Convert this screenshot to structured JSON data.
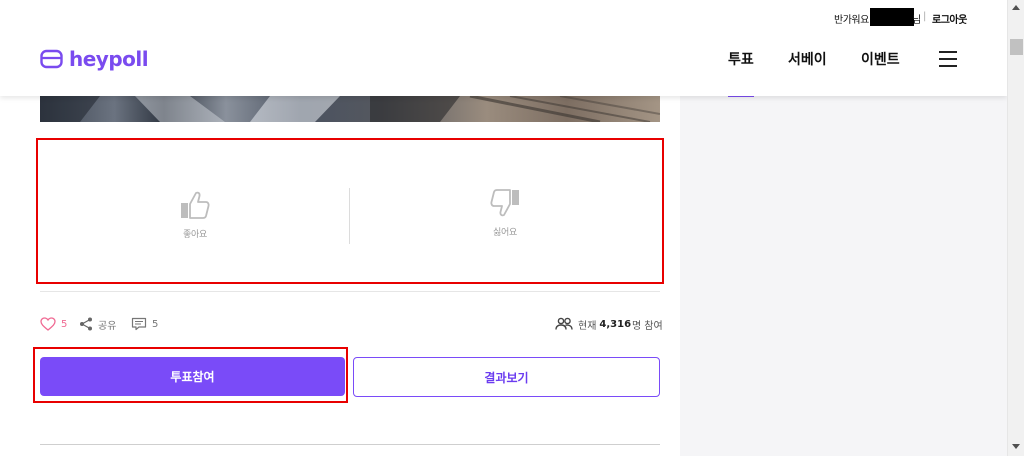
{
  "header": {
    "greeting": "반가워요",
    "greeting_suffix": "님",
    "separator": "|",
    "logout_label": "로그아웃",
    "logo_text": "heypoll",
    "nav": [
      {
        "label": "투표"
      },
      {
        "label": "서베이"
      },
      {
        "label": "이벤트"
      }
    ],
    "menu_icon": "hamburger-icon"
  },
  "vote_panel": {
    "like_label": "좋아요",
    "dislike_label": "싫어요",
    "like_icon": "thumbs-up-icon",
    "dislike_icon": "thumbs-down-icon"
  },
  "stats": {
    "likes": "5",
    "share_label": "공유",
    "comments": "5",
    "participants_prefix": "현재",
    "participants_count": "4,316",
    "participants_unit": "명",
    "participants_suffix": "참여"
  },
  "actions": {
    "vote_label": "투표참여",
    "result_label": "결과보기"
  },
  "colors": {
    "brand": "#7a4bf8",
    "heart": "#f06a93",
    "highlight_box": "#e80000"
  }
}
